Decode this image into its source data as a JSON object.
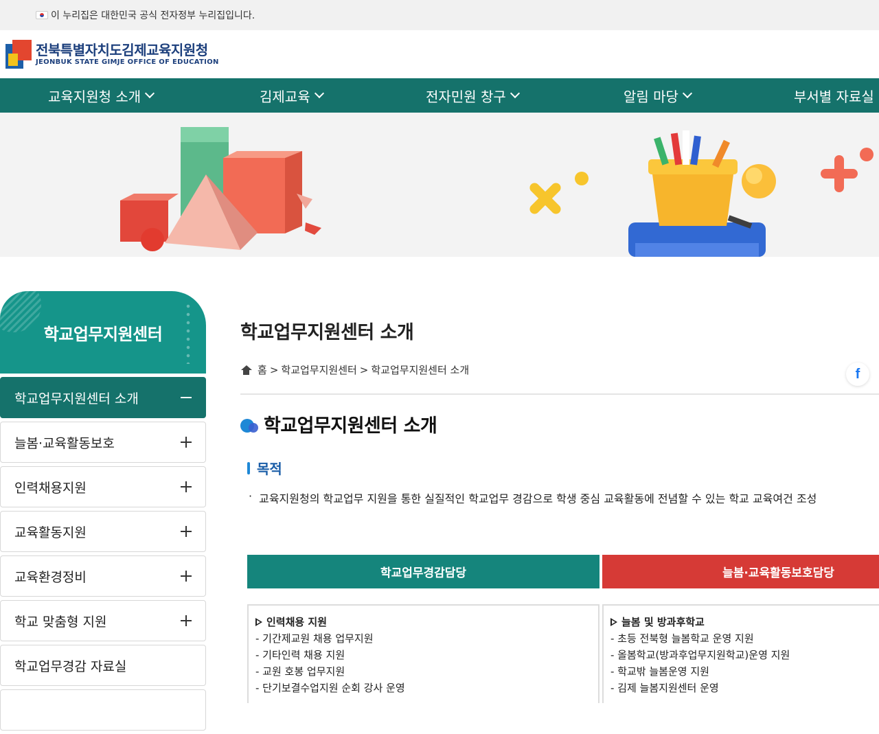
{
  "gov_notice": {
    "text": "이 누리집은 대한민국 공식 전자정부 누리집입니다."
  },
  "logo": {
    "ko": "전북특별자치도김제교육지원청",
    "en": "JEONBUK STATE GIMJE OFFICE OF EDUCATION"
  },
  "gnb": [
    {
      "label": "교육지원청 소개"
    },
    {
      "label": "김제교육"
    },
    {
      "label": "전자민원 창구"
    },
    {
      "label": "알림 마당"
    },
    {
      "label": "부서별 자료실"
    }
  ],
  "lnb": {
    "title": "학교업무지원센터",
    "items": [
      {
        "label": "학교업무지원센터 소개",
        "state": "expanded"
      },
      {
        "label": "늘봄·교육활동보호",
        "state": "collapsed"
      },
      {
        "label": "인력채용지원",
        "state": "collapsed"
      },
      {
        "label": "교육활동지원",
        "state": "collapsed"
      },
      {
        "label": "교육환경정비",
        "state": "collapsed"
      },
      {
        "label": "학교 맞춤형 지원",
        "state": "collapsed"
      },
      {
        "label": "학교업무경감 자료실",
        "state": "none"
      }
    ]
  },
  "content": {
    "page_title": "학교업무지원센터 소개",
    "breadcrumb": {
      "home": "홈",
      "sep": ">",
      "level1": "학교업무지원센터",
      "level2": "학교업무지원센터 소개"
    },
    "share_icon": "facebook-icon",
    "section_title": "학교업무지원센터 소개",
    "purpose_title": "목적",
    "purpose_text": "교육지원청의 학교업무 지원을 통한 실질적인 학교업무 경감으로 학생 중심 교육활동에 전념할 수 있는 학교 교육여건 조성",
    "departments": [
      {
        "name": "학교업무경감담당",
        "color": "#15857c",
        "group_title": "인력채용 지원",
        "lines": [
          "- 기간제교원 채용 업무지원",
          "- 기타인력 채용 지원",
          "- 교원 호봉 업무지원",
          "- 단기보결수업지원 순회 강사 운영"
        ]
      },
      {
        "name": "늘봄·교육활동보호담당",
        "color": "#d63a36",
        "group_title": "늘봄 및 방과후학교",
        "lines": [
          "- 초등 전북형 늘봄학교 운영 지원",
          "- 올봄학교(방과후업무지원학교)운영 지원",
          "- 학교밖 늘봄운영 지원",
          "- 김제 늘봄지원센터 운영"
        ]
      }
    ]
  },
  "colors": {
    "gnb_bg": "#15726b",
    "lnb_head_bg": "#15958a",
    "accent_blue": "#1b5ea8"
  }
}
